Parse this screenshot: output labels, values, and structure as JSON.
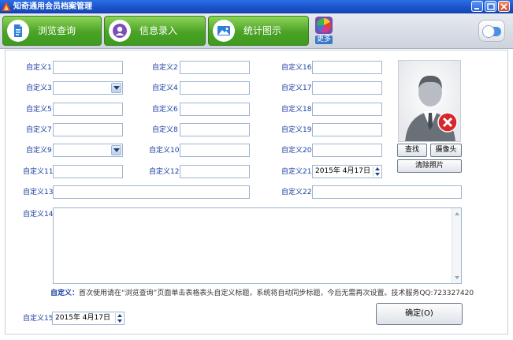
{
  "window": {
    "title": "知奇通用会员档案管理",
    "colors": {
      "titlebar": "#1a52c8",
      "toolbar_green": "#4aa325",
      "label_blue": "#1a3fa0",
      "close": "#d24424"
    }
  },
  "toolbar": {
    "browse_label": "浏览查询",
    "entry_label": "信息录入",
    "stats_label": "统计图示",
    "more_label": "更多"
  },
  "fields": {
    "f1": "自定义1",
    "f2": "自定义2",
    "f3": "自定义3",
    "f4": "自定义4",
    "f5": "自定义5",
    "f6": "自定义6",
    "f7": "自定义7",
    "f8": "自定义8",
    "f9": "自定义9",
    "f10": "自定义10",
    "f11": "自定义11",
    "f12": "自定义12",
    "f13": "自定义13",
    "f14": "自定义14",
    "f15": "自定义15",
    "f16": "自定义16",
    "f17": "自定义17",
    "f18": "自定义18",
    "f19": "自定义19",
    "f20": "自定义20",
    "f21": "自定义21",
    "f22": "自定义22"
  },
  "values": {
    "date21": "2015年  4月17日",
    "date15": "2015年  4月17日"
  },
  "photo": {
    "find_label": "查找",
    "camera_label": "摄像头",
    "clear_label": "清除照片"
  },
  "note": {
    "title": "自定义：",
    "body": "首次使用请在“浏览查询”页面单击表格表头自定义标题，系统将自动同步标题，今后无需再次设置。技术服务QQ:723327420"
  },
  "confirm_label": "确定(O)"
}
